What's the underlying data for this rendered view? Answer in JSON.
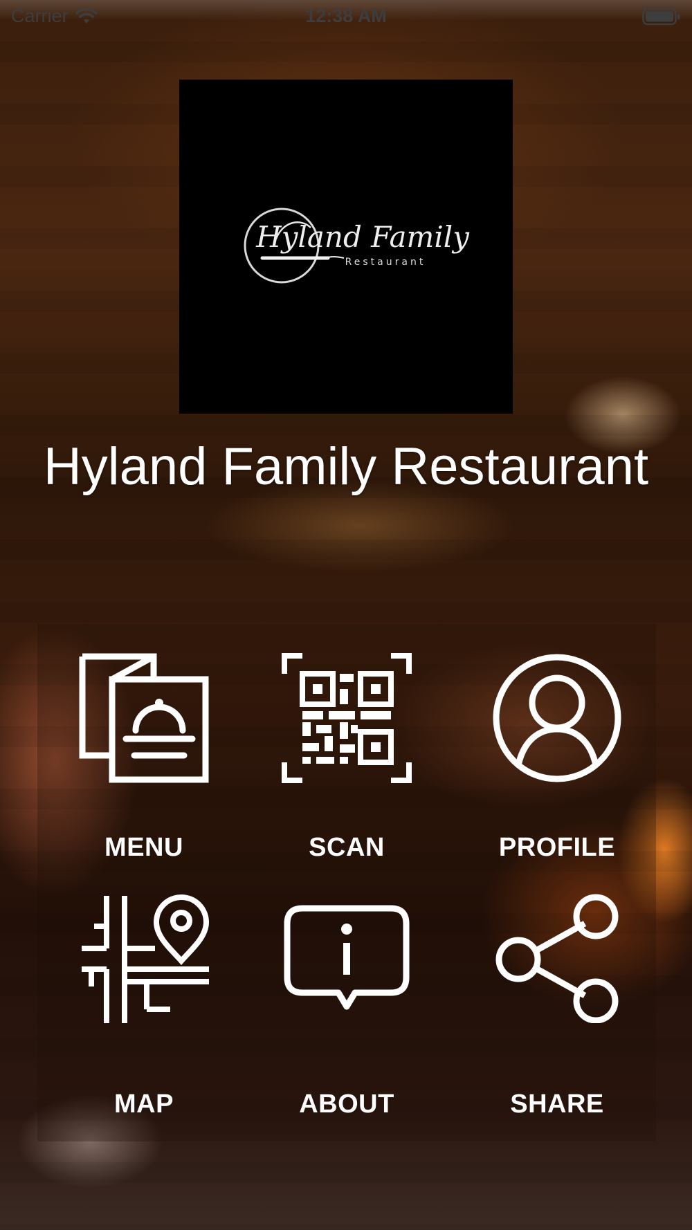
{
  "status_bar": {
    "carrier": "Carrier",
    "time": "12:38 AM",
    "wifi_icon": "wifi-icon",
    "battery_icon": "battery-icon"
  },
  "logo": {
    "script_text": "Hyland Family",
    "sub_text": "Restaurant"
  },
  "restaurant_name": "Hyland Family Restaurant",
  "tiles": [
    {
      "label": "MENU",
      "icon": "menu-book-cloche-icon"
    },
    {
      "label": "SCAN",
      "icon": "qr-code-icon"
    },
    {
      "label": "PROFILE",
      "icon": "user-profile-icon"
    },
    {
      "label": "MAP",
      "icon": "map-pin-icon"
    },
    {
      "label": "ABOUT",
      "icon": "info-bubble-icon"
    },
    {
      "label": "SHARE",
      "icon": "share-icon"
    }
  ],
  "colors": {
    "text": "#ffffff",
    "status_text": "#3d3d3d",
    "logo_background": "#000000"
  }
}
